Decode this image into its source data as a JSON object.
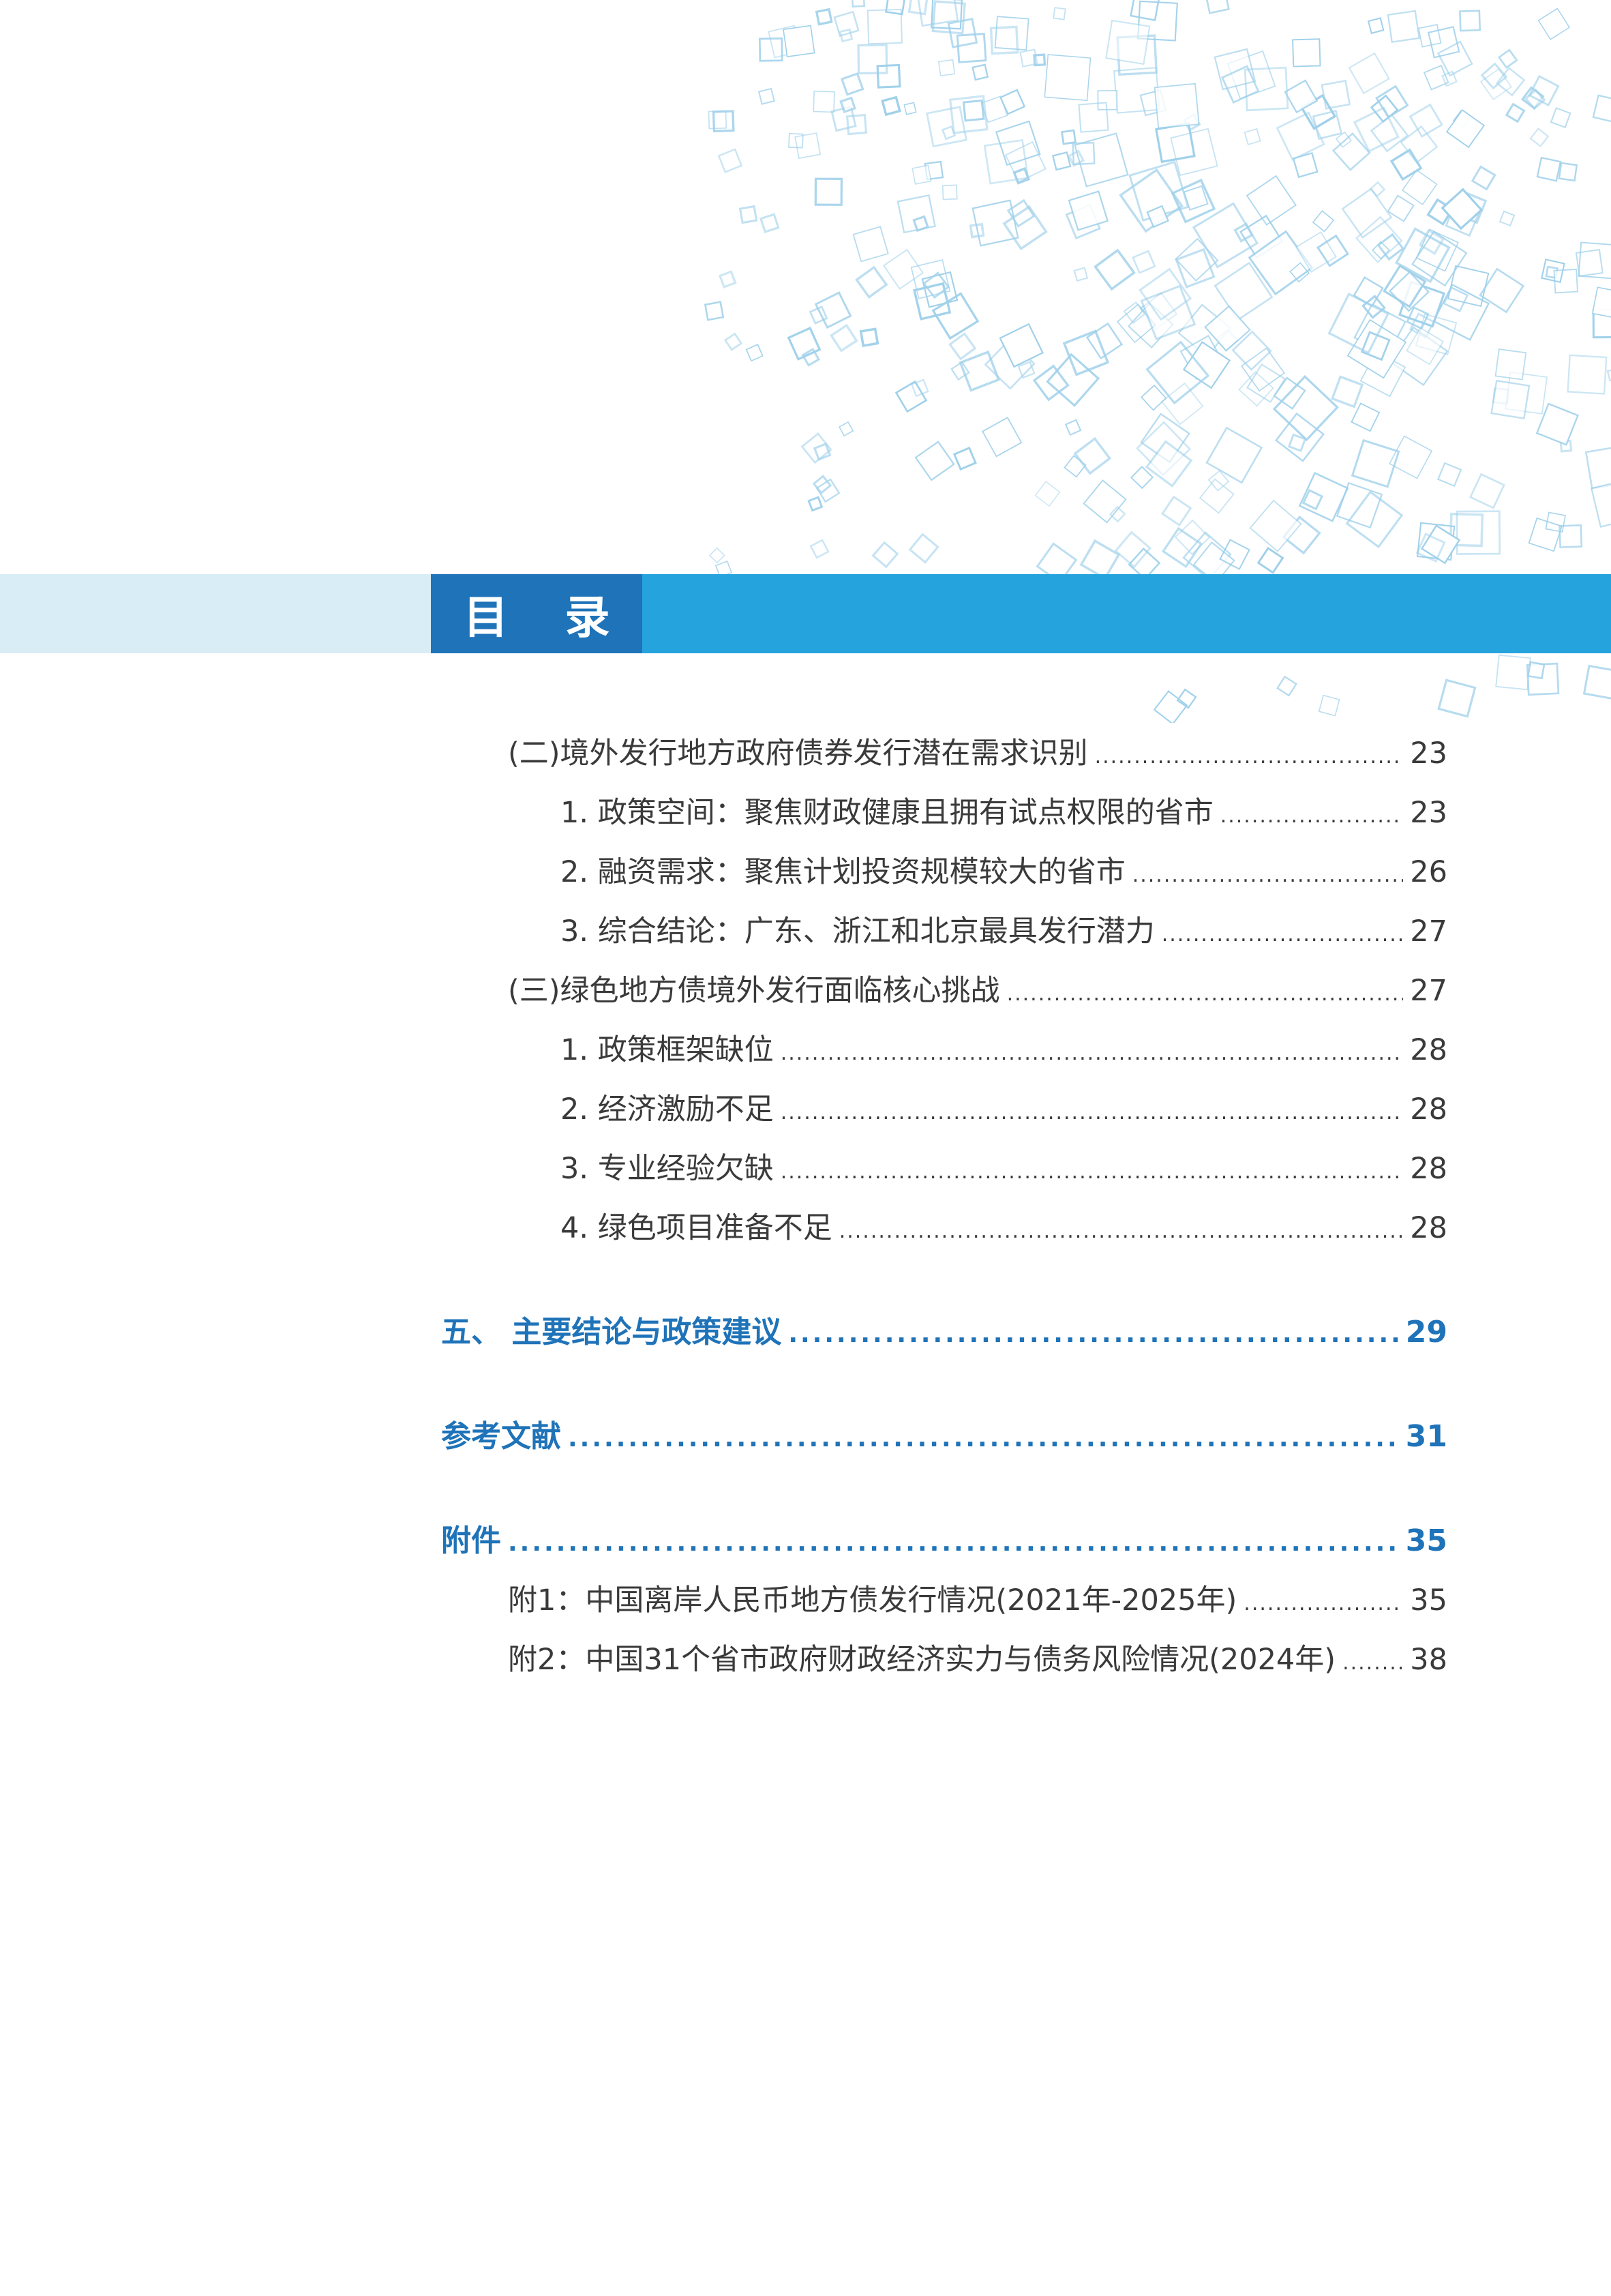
{
  "header": {
    "title": "目 录"
  },
  "colors": {
    "title_box": "#1f73b8",
    "band_blue": "#25a3dd",
    "band_light": "#d9edf6",
    "main_entry": "#1f73b8",
    "sub_entry": "#3a3a3a",
    "decoration": "#9fd0ea"
  },
  "dot_leader": "........................................................................................................................................................................................................",
  "toc": [
    {
      "label": "(二)境外发行地方政府债券发行潜在需求识别",
      "page": "23"
    },
    {
      "label": "1. 政策空间：聚焦财政健康且拥有试点权限的省市",
      "page": "23"
    },
    {
      "label": "2. 融资需求：聚焦计划投资规模较大的省市",
      "page": "26"
    },
    {
      "label": "3. 综合结论：广东、浙江和北京最具发行潜力",
      "page": "27"
    },
    {
      "label": "(三)绿色地方债境外发行面临核心挑战",
      "page": "27"
    },
    {
      "label": "1. 政策框架缺位",
      "page": "28"
    },
    {
      "label": "2. 经济激励不足",
      "page": "28"
    },
    {
      "label": "3. 专业经验欠缺",
      "page": "28"
    },
    {
      "label": "4. 绿色项目准备不足",
      "page": "28"
    },
    {
      "label": "五、 主要结论与政策建议",
      "page": "29"
    },
    {
      "label": "参考文献",
      "page": "31"
    },
    {
      "label": "附件",
      "page": "35"
    },
    {
      "label": "附1：中国离岸人民币地方债发行情况(2021年-2025年)",
      "page": "35"
    },
    {
      "label": "附2：中国31个省市政府财政经济实力与债务风险情况(2024年)",
      "page": "38"
    }
  ]
}
